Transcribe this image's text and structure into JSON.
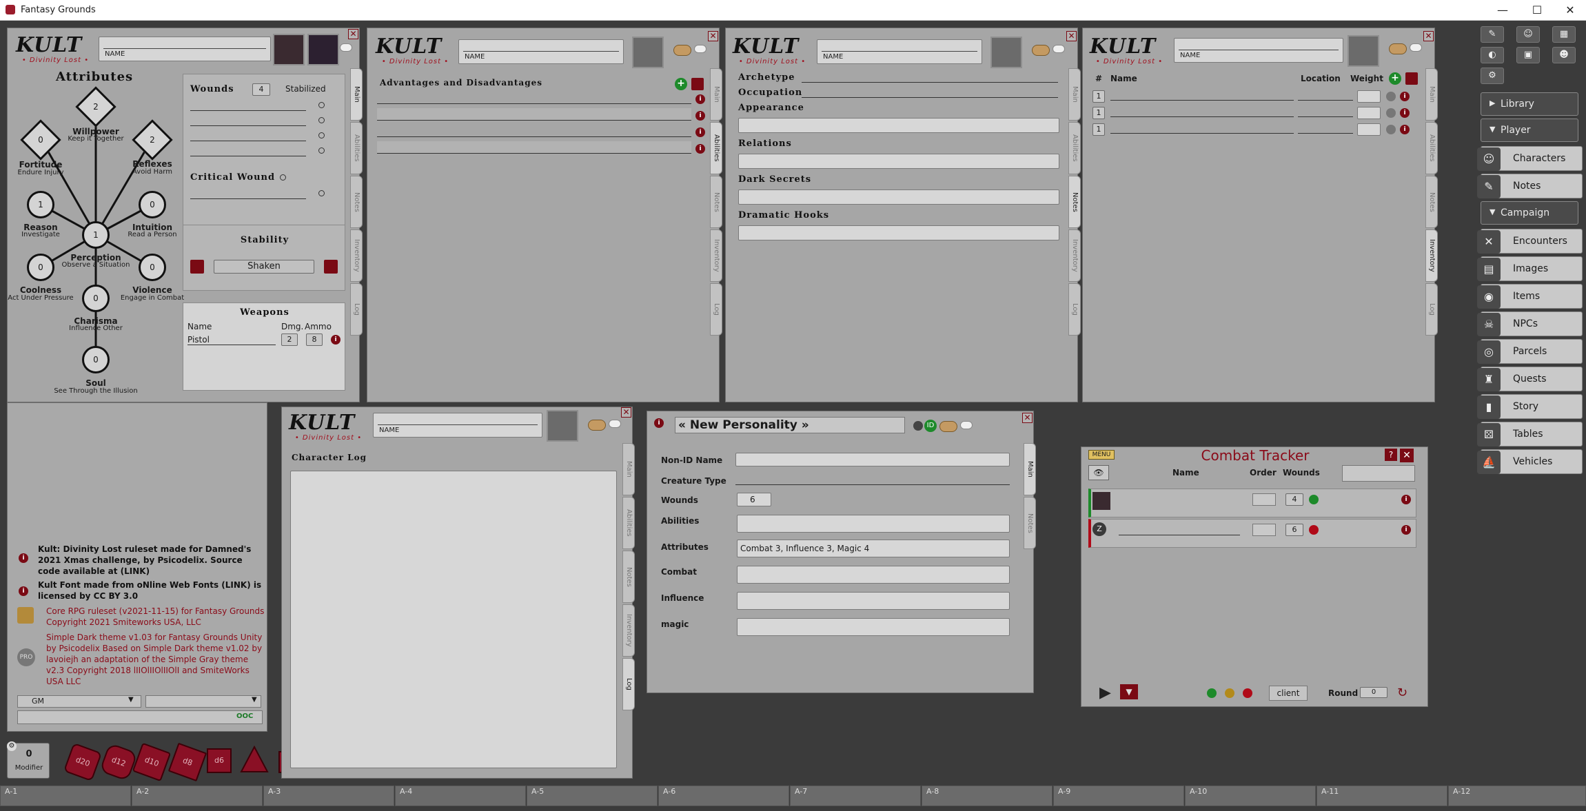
{
  "app": {
    "title": "Fantasy Grounds"
  },
  "window_controls": {
    "minimize": "—",
    "maximize": "☐",
    "close": "✕"
  },
  "kult_logo": {
    "brand": "KULT",
    "sub": "• Divinity Lost •"
  },
  "sheet_tabs": [
    "Main",
    "Abilities",
    "Notes",
    "Inventory",
    "Log"
  ],
  "main_sheet": {
    "name_label": "NAME",
    "attributes_title": "Attributes",
    "attributes": [
      {
        "name": "Willpower",
        "sub": "Keep it Together",
        "value": "2"
      },
      {
        "name": "Fortitude",
        "sub": "Endure Injury",
        "value": "0"
      },
      {
        "name": "Reflexes",
        "sub": "Avoid Harm",
        "value": "2"
      },
      {
        "name": "Reason",
        "sub": "Investigate",
        "value": "1"
      },
      {
        "name": "Intuition",
        "sub": "Read a Person",
        "value": "0"
      },
      {
        "name": "Perception",
        "sub": "Observe a Situation",
        "value": "1"
      },
      {
        "name": "Coolness",
        "sub": "Act Under Pressure",
        "value": "0"
      },
      {
        "name": "Violence",
        "sub": "Engage in Combat",
        "value": "0"
      },
      {
        "name": "Charisma",
        "sub": "Influence Other",
        "value": "0"
      },
      {
        "name": "Soul",
        "sub": "See Through the Illusion",
        "value": "0"
      }
    ],
    "wounds_label": "Wounds",
    "wounds_value": "4",
    "stabilized_label": "Stabilized",
    "critical_label": "Critical Wound",
    "stability_label": "Stability",
    "stability_value": "Shaken",
    "weapons_title": "Weapons",
    "weapons_col_name": "Name",
    "weapons_col_dmg": "Dmg.",
    "weapons_col_ammo": "Ammo",
    "weapon": {
      "name": "Pistol",
      "dmg": "2",
      "ammo": "8"
    }
  },
  "abilities_sheet": {
    "name_label": "NAME",
    "title": "Advantages and Disadvantages"
  },
  "notes_sheet": {
    "name_label": "NAME",
    "archetype": "Archetype",
    "occupation": "Occupation",
    "appearance": "Appearance",
    "relations": "Relations",
    "dark_secrets": "Dark Secrets",
    "dramatic_hooks": "Dramatic Hooks"
  },
  "inventory_sheet": {
    "name_label": "NAME",
    "col_hash": "#",
    "col_name": "Name",
    "col_location": "Location",
    "col_weight": "Weight",
    "counts": [
      "1",
      "1",
      "1"
    ]
  },
  "log_sheet": {
    "name_label": "NAME",
    "title": "Character Log"
  },
  "npc": {
    "title": "« New Personality »",
    "nonid_label": "Non-ID Name",
    "creature_label": "Creature Type",
    "wounds_label": "Wounds",
    "wounds_value": "6",
    "abilities_label": "Abilities",
    "attributes_label": "Attributes",
    "attributes_value": "Combat 3, Influence 3, Magic 4",
    "combat_label": "Combat",
    "influence_label": "Influence",
    "magic_label": "magic",
    "tabs": [
      "Main",
      "Notes"
    ]
  },
  "combat": {
    "menu": "MENU",
    "title": "Combat Tracker",
    "col_name": "Name",
    "col_order": "Order",
    "col_wounds": "Wounds",
    "row1_wounds": "4",
    "row2_wounds": "6",
    "client_btn": "client",
    "round_label": "Round",
    "round_value": "0"
  },
  "chat": {
    "credits": [
      {
        "text": "Kult: Divinity Lost ruleset made for Damned's 2021 Xmas challenge, by Psicodelix. Source code available at (LINK)",
        "style": "dark"
      },
      {
        "text": "Kult Font made from oNline Web Fonts (LINK) is licensed by CC BY 3.0",
        "style": "dark"
      },
      {
        "text": "Core RPG ruleset (v2021-11-15) for Fantasy Grounds Copyright 2021 Smiteworks USA, LLC",
        "style": "red"
      },
      {
        "text": "Simple Dark theme v1.03 for Fantasy Grounds Unity by Psicodelix Based on Simple Dark theme v1.02 by lavoiejh an adaptation of the Simple Gray theme v2.3 Copyright 2018 lIIOlIIOlIIOlI and SmiteWorks USA LLC",
        "style": "red"
      }
    ],
    "identity": "GM",
    "ooc": "OOC",
    "modifier_value": "0",
    "modifier_label": "Modifier",
    "dice": [
      "d20",
      "d12",
      "d10",
      "d8",
      "d6",
      "d4"
    ]
  },
  "sidebar": {
    "library": "Library",
    "player": "Player",
    "campaign": "Campaign",
    "player_items": [
      "Characters",
      "Notes"
    ],
    "campaign_items": [
      "Encounters",
      "Images",
      "Items",
      "NPCs",
      "Parcels",
      "Quests",
      "Story",
      "Tables",
      "Vehicles"
    ]
  },
  "hotkeys": [
    "A-1",
    "A-2",
    "A-3",
    "A-4",
    "A-5",
    "A-6",
    "A-7",
    "A-8",
    "A-9",
    "A-10",
    "A-11",
    "A-12"
  ]
}
